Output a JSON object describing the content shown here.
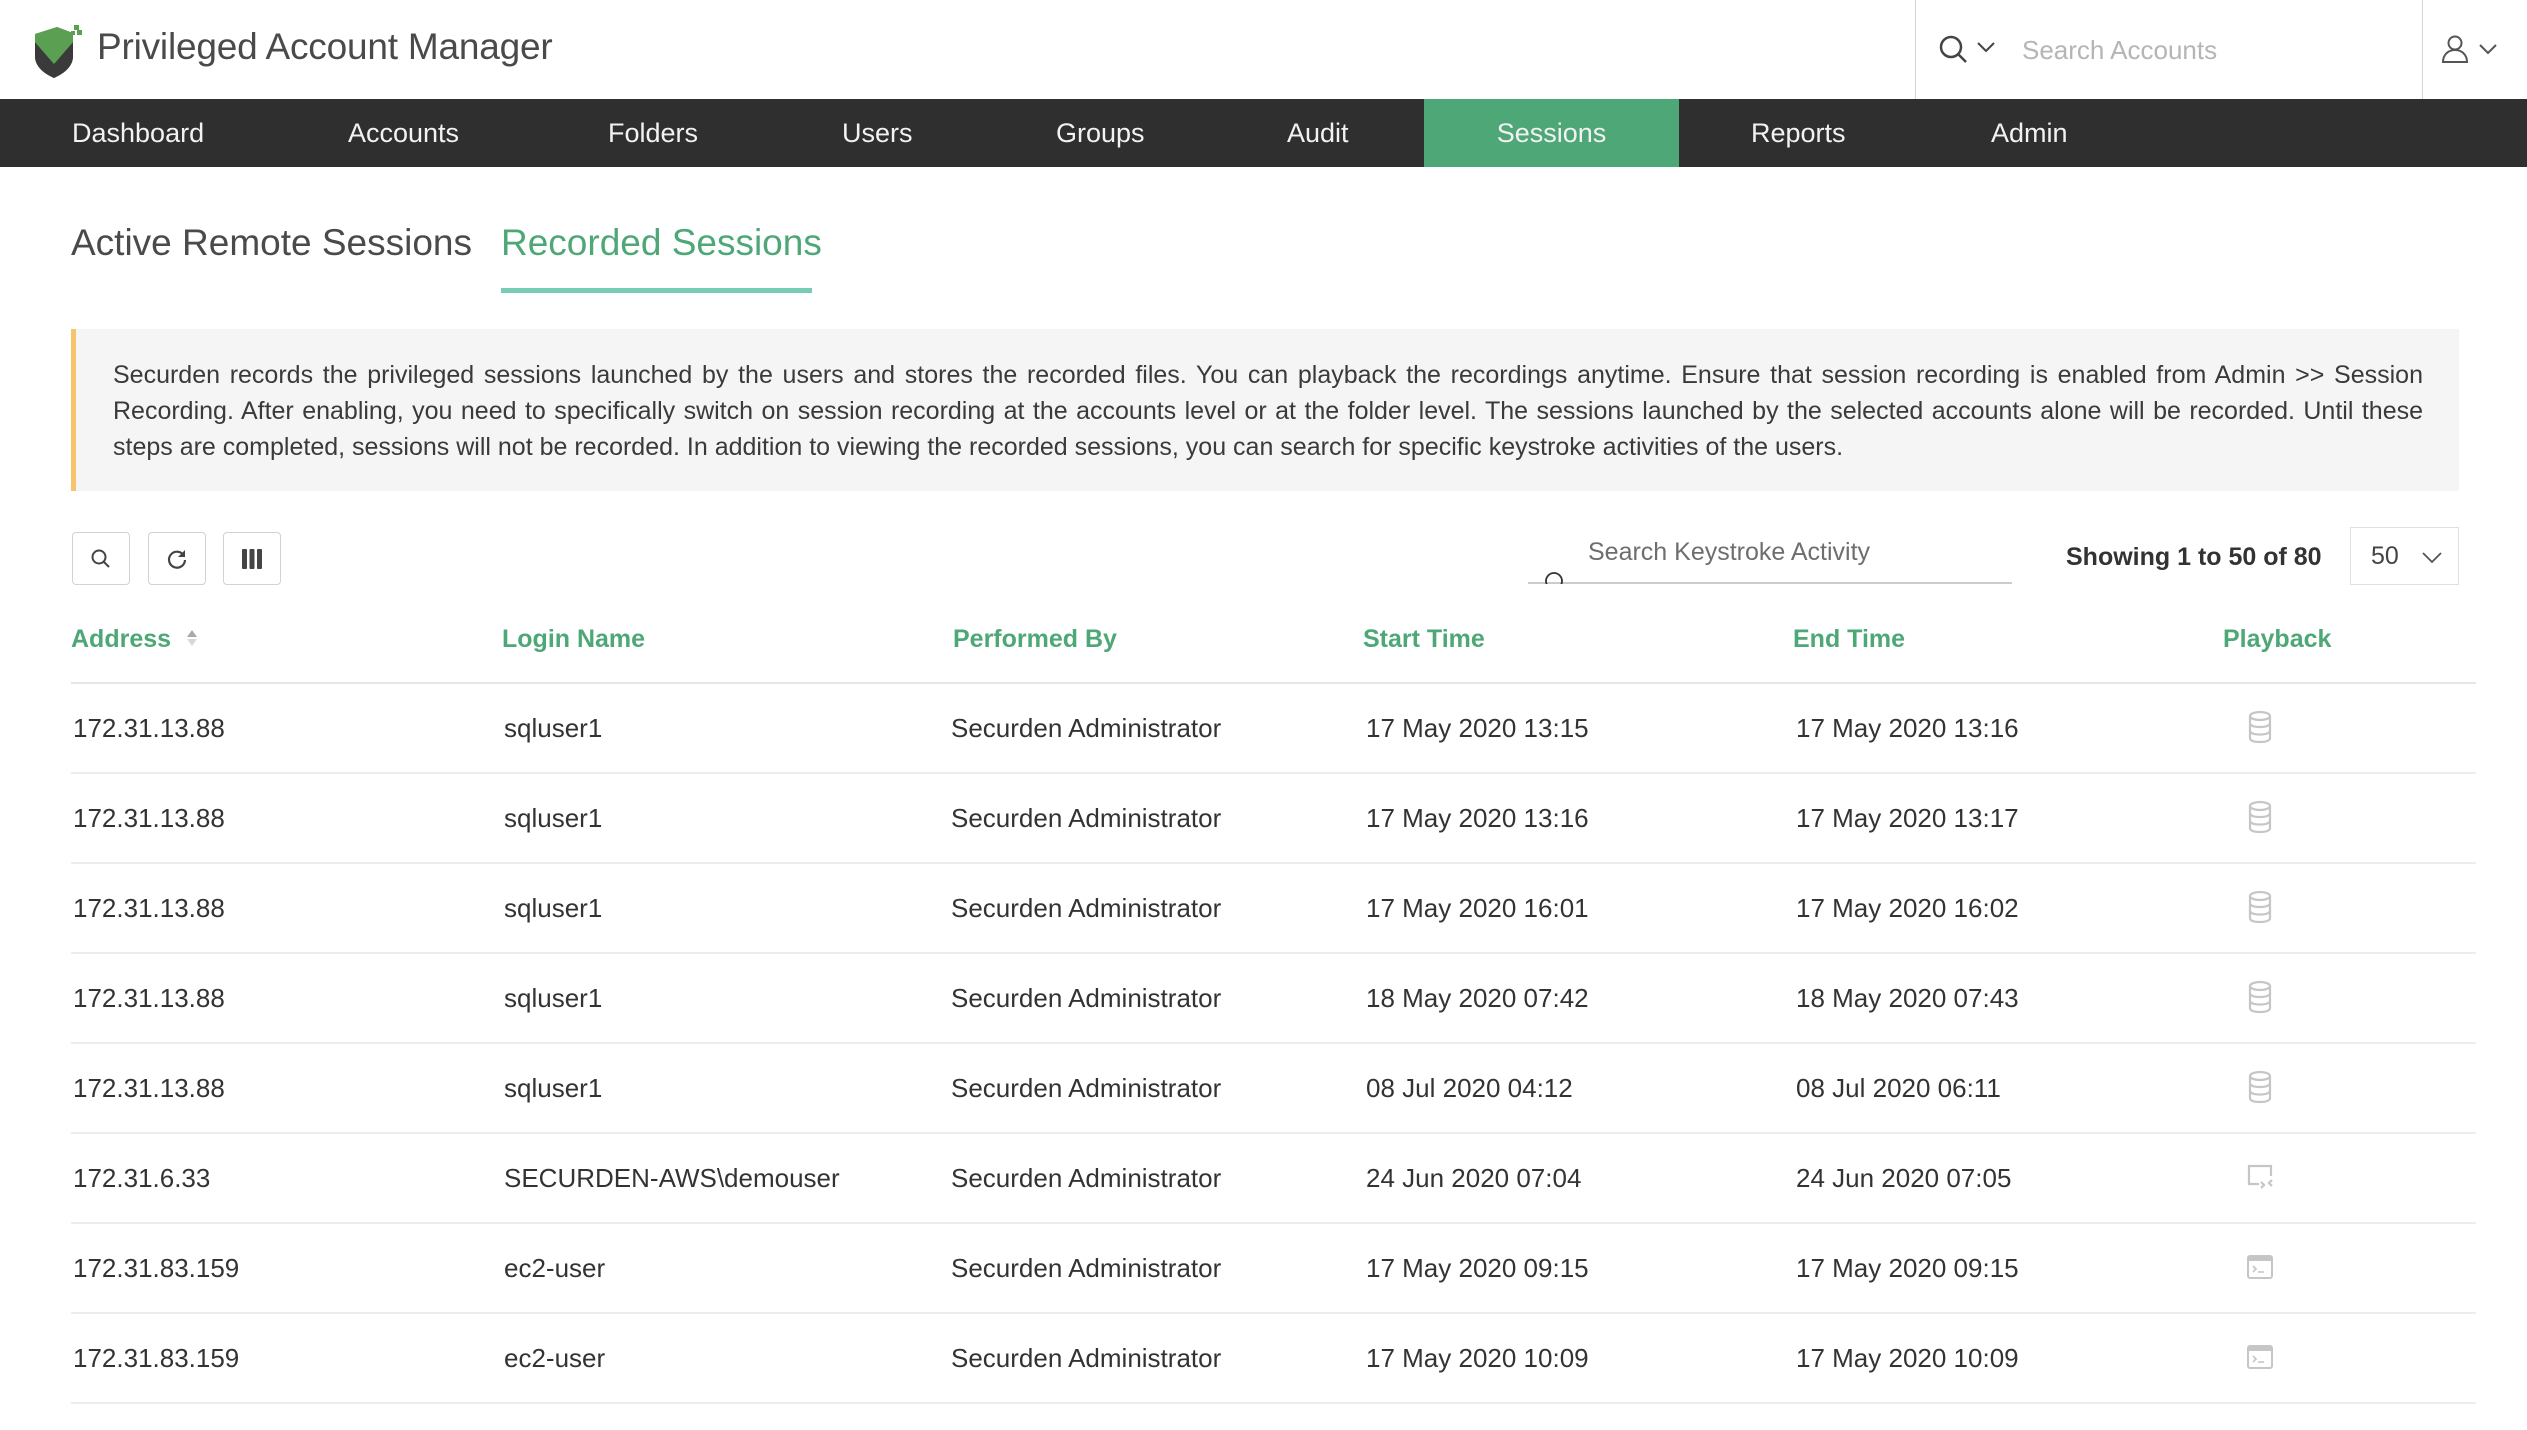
{
  "app": {
    "title": "Privileged Account Manager",
    "brand_color": "#4ea777",
    "search_placeholder": "Search Accounts"
  },
  "nav": {
    "items": [
      {
        "label": "Dashboard",
        "active": false
      },
      {
        "label": "Accounts",
        "active": false
      },
      {
        "label": "Folders",
        "active": false
      },
      {
        "label": "Users",
        "active": false
      },
      {
        "label": "Groups",
        "active": false
      },
      {
        "label": "Audit",
        "active": false
      },
      {
        "label": "Sessions",
        "active": true
      },
      {
        "label": "Reports",
        "active": false
      },
      {
        "label": "Admin",
        "active": false
      }
    ]
  },
  "tabs": [
    {
      "label": "Active Remote Sessions",
      "active": false
    },
    {
      "label": "Recorded Sessions",
      "active": true
    }
  ],
  "banner": {
    "text": "Securden records the privileged sessions launched by the users and stores the recorded files. You can playback the recordings anytime. Ensure that session recording is enabled from Admin >> Session Recording. After enabling, you need to specifically switch on session recording at the accounts level or at the folder level. The sessions launched by the selected accounts alone will be recorded. Until these steps are completed, sessions will not be recorded. In addition to viewing the recorded sessions, you can search for specific keystroke activities of the users."
  },
  "toolbar": {
    "search_button": "search-icon",
    "refresh_button": "refresh-icon",
    "columns_button": "columns-icon",
    "keystroke_placeholder": "Search Keystroke Activity",
    "showing_text": "Showing 1 to 50 of 80",
    "page_size": "50"
  },
  "table": {
    "columns": [
      "Address",
      "Login Name",
      "Performed By",
      "Start Time",
      "End Time",
      "Playback"
    ],
    "rows": [
      {
        "address": "172.31.13.88",
        "login": "sqluser1",
        "performed_by": "Securden Administrator",
        "start": "17 May 2020 13:15",
        "end": "17 May 2020 13:16",
        "playback_icon": "database-icon"
      },
      {
        "address": "172.31.13.88",
        "login": "sqluser1",
        "performed_by": "Securden Administrator",
        "start": "17 May 2020 13:16",
        "end": "17 May 2020 13:17",
        "playback_icon": "database-icon"
      },
      {
        "address": "172.31.13.88",
        "login": "sqluser1",
        "performed_by": "Securden Administrator",
        "start": "17 May 2020 16:01",
        "end": "17 May 2020 16:02",
        "playback_icon": "database-icon"
      },
      {
        "address": "172.31.13.88",
        "login": "sqluser1",
        "performed_by": "Securden Administrator",
        "start": "18 May 2020 07:42",
        "end": "18 May 2020 07:43",
        "playback_icon": "database-icon"
      },
      {
        "address": "172.31.13.88",
        "login": "sqluser1",
        "performed_by": "Securden Administrator",
        "start": "08 Jul 2020 04:12",
        "end": "08 Jul 2020 06:11",
        "playback_icon": "database-icon"
      },
      {
        "address": "172.31.6.33",
        "login": "SECURDEN-AWS\\demouser",
        "performed_by": "Securden Administrator",
        "start": "24 Jun 2020 07:04",
        "end": "24 Jun 2020 07:05",
        "playback_icon": "remote-desktop-icon"
      },
      {
        "address": "172.31.83.159",
        "login": "ec2-user",
        "performed_by": "Securden Administrator",
        "start": "17 May 2020 09:15",
        "end": "17 May 2020 09:15",
        "playback_icon": "terminal-icon"
      },
      {
        "address": "172.31.83.159",
        "login": "ec2-user",
        "performed_by": "Securden Administrator",
        "start": "17 May 2020 10:09",
        "end": "17 May 2020 10:09",
        "playback_icon": "terminal-icon"
      }
    ]
  }
}
